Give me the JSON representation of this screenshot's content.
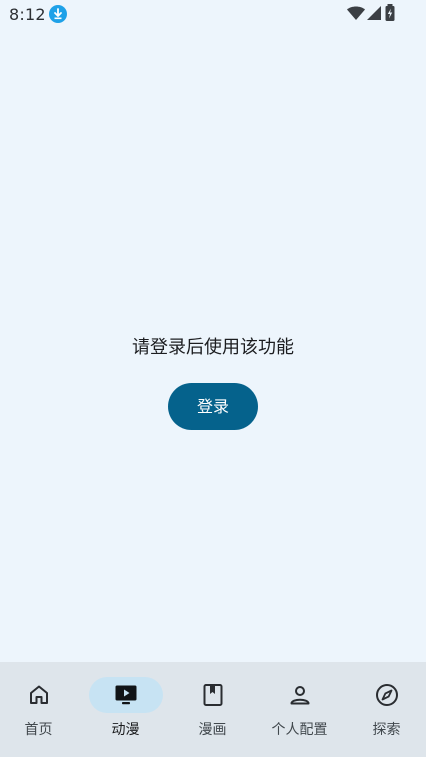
{
  "status_bar": {
    "time": "8:12",
    "icons": [
      "download-notification-icon",
      "wifi-icon",
      "signal-icon",
      "battery-charging-icon"
    ],
    "download_icon_color": "#1ea1e8"
  },
  "main": {
    "prompt": "请登录后使用该功能",
    "login_button_label": "登录"
  },
  "bottom_nav": {
    "active_index": 1,
    "items": [
      {
        "label": "首页",
        "icon": "home-icon"
      },
      {
        "label": "动漫",
        "icon": "tv-play-icon"
      },
      {
        "label": "漫画",
        "icon": "book-icon"
      },
      {
        "label": "个人配置",
        "icon": "person-icon"
      },
      {
        "label": "探索",
        "icon": "compass-icon"
      }
    ]
  },
  "colors": {
    "background": "#edf5fc",
    "accent": "#05628c",
    "nav_background": "#dee5eb",
    "nav_active_indicator": "#c7e3f3"
  }
}
